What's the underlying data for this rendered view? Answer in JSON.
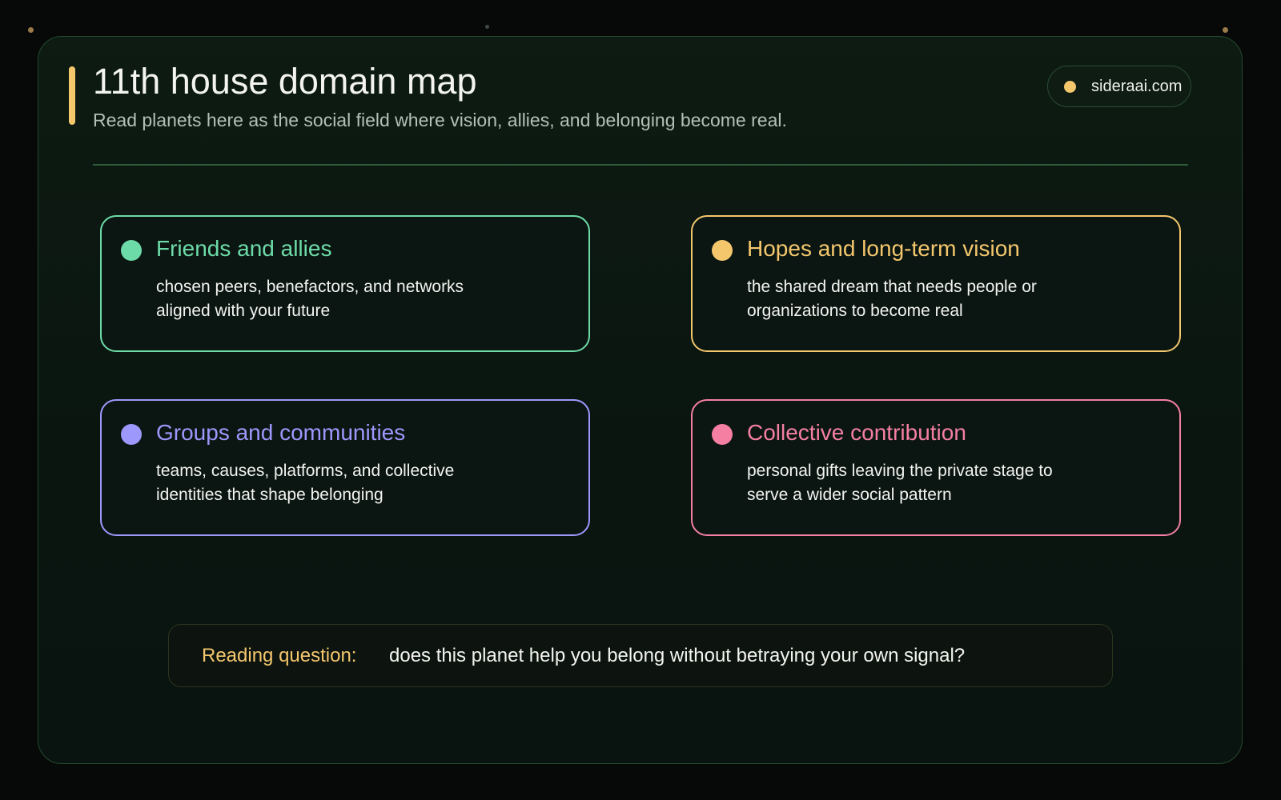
{
  "header": {
    "title": "11th house domain map",
    "subtitle": "Read planets here as the social field where vision, allies, and belonging become real."
  },
  "brand": {
    "label": "sideraai.com",
    "dot_color": "#f4c76d"
  },
  "cards": [
    {
      "title": "Friends and allies",
      "description": "chosen peers, benefactors, and networks aligned with your future",
      "color": "#6ddba8",
      "icon": "green-dot-icon"
    },
    {
      "title": "Hopes and long-term vision",
      "description": "the shared dream that needs people or organizations to become real",
      "color": "#f4c76d",
      "icon": "gold-dot-icon"
    },
    {
      "title": "Groups and communities",
      "description": "teams, causes, platforms, and collective identities that shape belonging",
      "color": "#9c98fc",
      "icon": "violet-dot-icon"
    },
    {
      "title": "Collective contribution",
      "description": "personal gifts leaving the private stage to serve a wider social pattern",
      "color": "#f47fa3",
      "icon": "pink-dot-icon"
    }
  ],
  "question": {
    "label": "Reading question:",
    "text": "does this planet help you belong without betraying your own signal?"
  },
  "colors": {
    "accent": "#f4c76d",
    "background": "#060908",
    "panel": "#0c1912",
    "text": "#f3f4f0"
  }
}
